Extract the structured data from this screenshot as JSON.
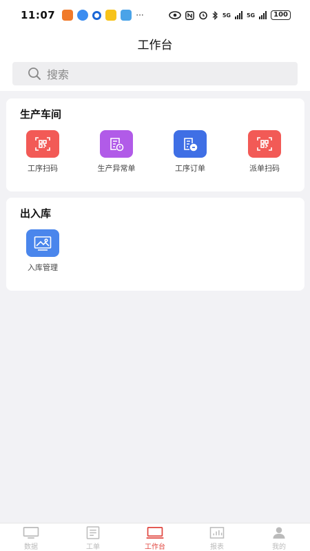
{
  "status": {
    "time": "11:07",
    "more": "···",
    "net1": "5G",
    "net2": "5G",
    "battery": "100"
  },
  "header": {
    "title": "工作台"
  },
  "search": {
    "placeholder": "搜索"
  },
  "sections": [
    {
      "title": "生产车间",
      "items": [
        {
          "label": "工序扫码",
          "icon": "qr-scan-icon",
          "color": "#f25a56"
        },
        {
          "label": "生产异常单",
          "icon": "exception-doc-icon",
          "color": "#b15be8"
        },
        {
          "label": "工序订单",
          "icon": "order-doc-icon",
          "color": "#3f6fe5"
        },
        {
          "label": "派单扫码",
          "icon": "qr-scan-icon",
          "color": "#f25a56"
        }
      ]
    },
    {
      "title": "出入库",
      "items": [
        {
          "label": "入库管理",
          "icon": "image-frame-icon",
          "color": "#4a86ec"
        }
      ]
    }
  ],
  "tabs": [
    {
      "label": "数据",
      "icon": "monitor-icon"
    },
    {
      "label": "工单",
      "icon": "document-icon"
    },
    {
      "label": "工作台",
      "icon": "laptop-icon",
      "active": true
    },
    {
      "label": "报表",
      "icon": "bar-chart-icon"
    },
    {
      "label": "我的",
      "icon": "person-icon"
    }
  ],
  "colors": {
    "accent": "#e0453e",
    "inactive_tab": "#bbbbbb",
    "background": "#f2f2f5"
  }
}
